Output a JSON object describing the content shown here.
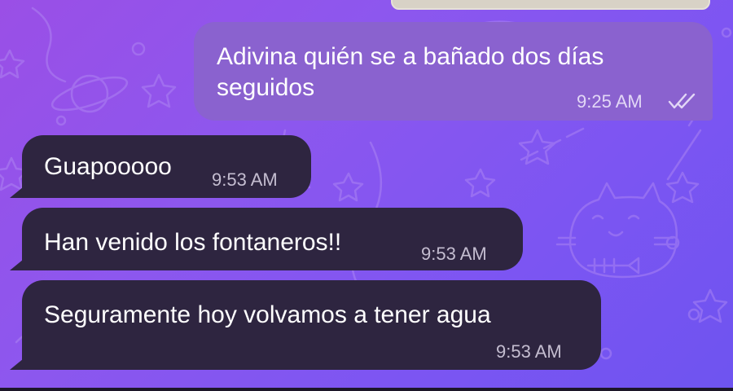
{
  "chat": {
    "messages": [
      {
        "direction": "outgoing",
        "lines": [
          "Adivina quién se a bañado dos días",
          "seguidos"
        ],
        "time": "9:25 AM",
        "status": "read",
        "status_icon": "double-check-icon"
      },
      {
        "direction": "incoming",
        "text": "Guapooooo",
        "time": "9:53 AM"
      },
      {
        "direction": "incoming",
        "text": "Han venido los fontaneros!!",
        "time": "9:53 AM"
      },
      {
        "direction": "incoming",
        "text": "Seguramente hoy volvamos a tener agua",
        "time": "9:53 AM"
      }
    ]
  },
  "colors": {
    "wallpaper_gradient": [
      "#9a4fe6",
      "#6e54f0"
    ],
    "outgoing_bubble": "#8a62cf",
    "incoming_bubble": "#2e2540",
    "message_text": "#ffffff"
  }
}
